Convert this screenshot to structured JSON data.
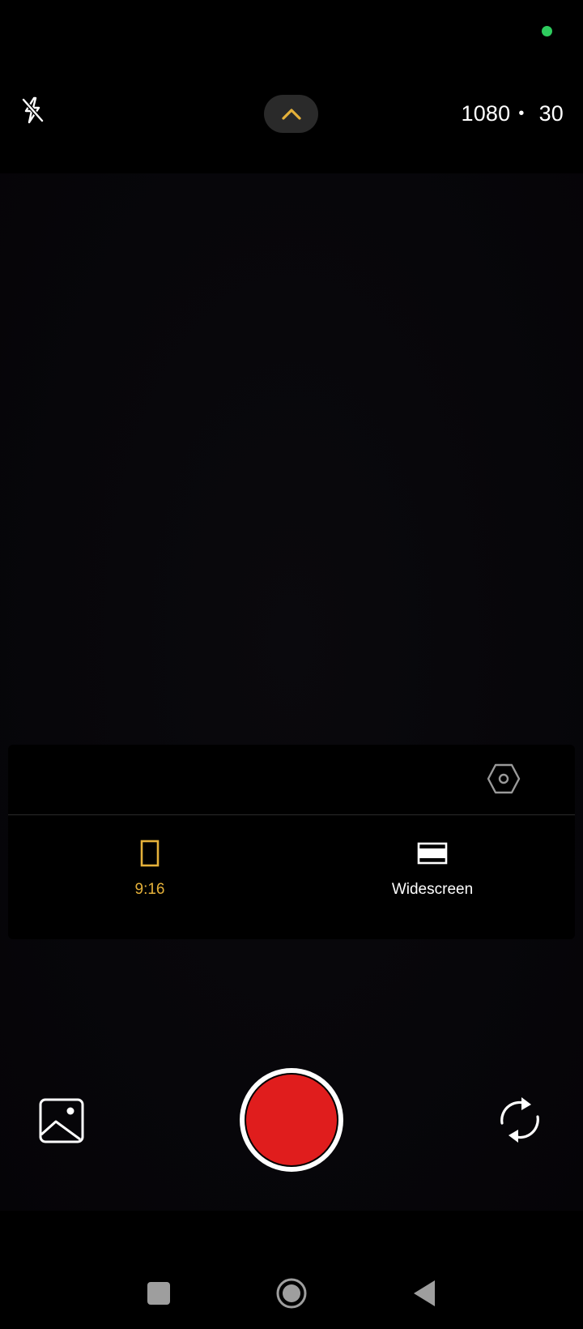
{
  "status_bar": {
    "indicator_color": "#2ecc5e"
  },
  "top_bar": {
    "flash_icon": "flash-off-icon",
    "expand_icon": "chevron-up-icon",
    "resolution": "1080",
    "separator": "•",
    "frame_rate": "30"
  },
  "settings_panel": {
    "settings_icon": "hexagon-settings-icon",
    "options": [
      {
        "label": "9:16",
        "icon": "portrait-frame-icon",
        "selected": true
      },
      {
        "label": "Widescreen",
        "icon": "widescreen-frame-icon",
        "selected": false
      }
    ],
    "accent_color": "#e5b13a"
  },
  "controls": {
    "gallery_icon": "gallery-icon",
    "record_icon": "record-button",
    "record_color": "#e01d1d",
    "switch_camera_icon": "switch-camera-icon"
  },
  "navigation": {
    "recents_icon": "recents-icon",
    "home_icon": "home-icon",
    "back_icon": "back-icon"
  }
}
